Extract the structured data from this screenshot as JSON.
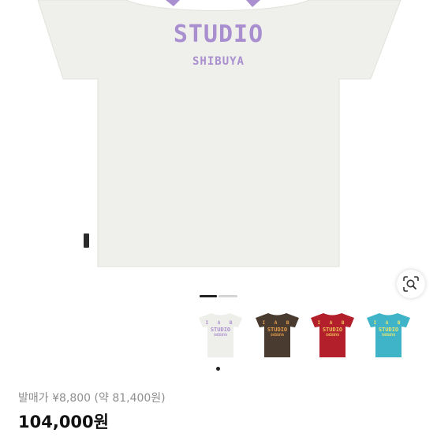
{
  "product": {
    "image_alt": "IAB STUDIO SHIBUYA T-shirt",
    "print_main": "STUDIO",
    "print_sub": "SHIBUYA",
    "base_color": "#efefeb",
    "print_color": "#a98fcf"
  },
  "gallery": {
    "image_count": 2,
    "current_index": 1,
    "lens_icon": "visual-search-icon"
  },
  "swatches": [
    {
      "name": "white",
      "color": "#eeeeea",
      "print": "#a98fcf",
      "letters": "I A B",
      "studio": "STUDIO",
      "city": "SHIBUYA"
    },
    {
      "name": "brown",
      "color": "#4a3b31",
      "print": "#e8a04a",
      "letters": "I A B",
      "studio": "STUDIO",
      "city": "SHIBUYA"
    },
    {
      "name": "red",
      "color": "#b3202b",
      "print": "#f1c55a",
      "letters": "I A B",
      "studio": "STUDIO",
      "city": "SHIBUYA"
    },
    {
      "name": "blue",
      "color": "#3fb4c8",
      "print": "#ece86a",
      "letters": "I A B",
      "studio": "STUDIO",
      "city": "SHIBUYA"
    }
  ],
  "selected_swatch": 0,
  "pricing": {
    "original_label": "발매가 ¥8,800 (약 81,400원)",
    "price": "104,000원"
  }
}
